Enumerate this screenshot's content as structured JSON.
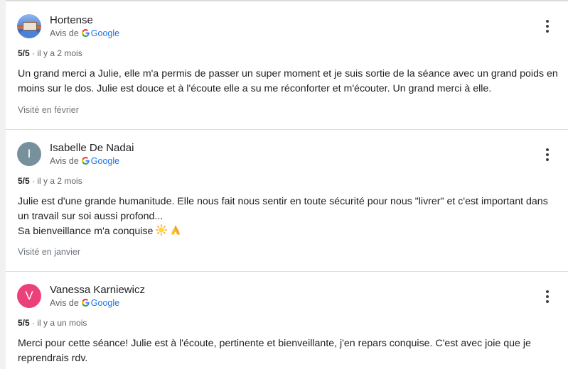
{
  "source_prefix": "Avis de",
  "source_brand": "Google",
  "menu_icon": "more-vert-icon",
  "colors": {
    "google_blue": "#4285F4",
    "google_red": "#EA4335",
    "google_yellow": "#FBBC05",
    "google_green": "#34A853",
    "avatar_gray": "#78909c",
    "avatar_pink": "#ec407a"
  },
  "reviews": [
    {
      "name": "Hortense",
      "avatar": "photo",
      "rating": "5/5",
      "time": "· il y a 2 mois",
      "text_lines": [
        "Un grand merci a Julie, elle m'a permis de passer un super moment et je suis sortie de la séance avec un grand poids en",
        "moins sur le dos. Julie est douce et à l'écoute elle a su me réconforter et m'écouter. Un grand merci à elle."
      ],
      "visited": "Visité en février"
    },
    {
      "name": "Isabelle De Nadai",
      "avatar_letter": "I",
      "rating": "5/5",
      "time": "· il y a 2 mois",
      "text_lines": [
        "Julie est d'une grande humanitude. Elle nous fait nous sentir en toute sécurité pour nous \"livrer\" et c'est important dans",
        "un travail sur soi aussi profond...",
        "Sa bienveillance m'a conquise"
      ],
      "emojis": [
        "sun-icon",
        "praying-hands-icon"
      ],
      "visited": "Visité en janvier"
    },
    {
      "name": "Vanessa Karniewicz",
      "avatar_letter": "V",
      "rating": "5/5",
      "time": "· il y a un mois",
      "text_lines": [
        "Merci pour cette séance! Julie est à l'écoute, pertinente et bienveillante, j'en repars conquise. C'est avec joie que je",
        "reprendrais rdv."
      ]
    }
  ]
}
